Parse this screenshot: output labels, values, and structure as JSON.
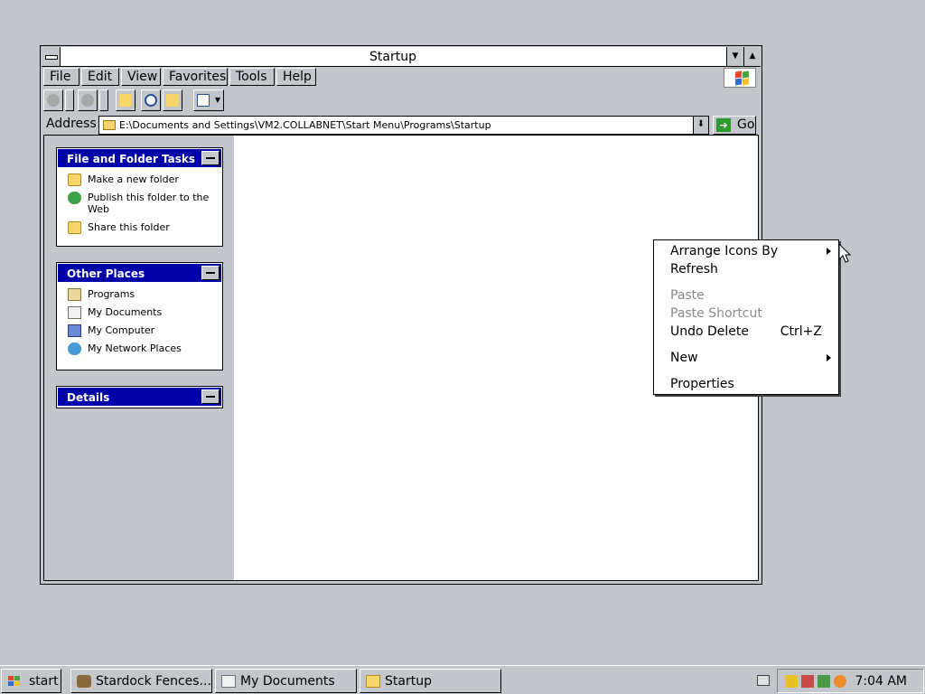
{
  "window": {
    "title": "Startup"
  },
  "menubar": {
    "items": [
      "File",
      "Edit",
      "View",
      "Favorites",
      "Tools",
      "Help"
    ]
  },
  "address": {
    "label": "Address",
    "value": "E:\\Documents and Settings\\VM2.COLLABNET\\Start Menu\\Programs\\Startup",
    "go_label": "Go"
  },
  "tasks": {
    "file_folder": {
      "title": "File and Folder Tasks",
      "items": [
        {
          "label": "Make a new folder",
          "icon": "new-folder-icon"
        },
        {
          "label": "Publish this folder to the Web",
          "icon": "publish-web-icon"
        },
        {
          "label": "Share this folder",
          "icon": "share-folder-icon"
        }
      ]
    },
    "other_places": {
      "title": "Other Places",
      "items": [
        {
          "label": "Programs",
          "icon": "programs-folder-icon"
        },
        {
          "label": "My Documents",
          "icon": "my-documents-icon"
        },
        {
          "label": "My Computer",
          "icon": "my-computer-icon"
        },
        {
          "label": "My Network Places",
          "icon": "network-places-icon"
        }
      ]
    },
    "details": {
      "title": "Details"
    }
  },
  "context_menu": {
    "items": [
      {
        "label": "Arrange Icons By",
        "submenu": true,
        "enabled": true
      },
      {
        "label": "Refresh",
        "enabled": true
      },
      {
        "label": "Paste",
        "enabled": false
      },
      {
        "label": "Paste Shortcut",
        "enabled": false
      },
      {
        "label": "Undo Delete",
        "shortcut": "Ctrl+Z",
        "enabled": true
      },
      {
        "label": "New",
        "submenu": true,
        "enabled": true
      },
      {
        "label": "Properties",
        "enabled": true
      }
    ]
  },
  "taskbar": {
    "start_label": "start",
    "buttons": [
      {
        "label": "Stardock Fences...",
        "icon": "fences-icon"
      },
      {
        "label": "My Documents",
        "icon": "document-icon"
      },
      {
        "label": "Startup",
        "icon": "folder-icon"
      }
    ],
    "clock": "7:04 AM"
  },
  "colors": {
    "panel_header": "#0000a8",
    "desktop": "#c3c7cb",
    "disabled_text": "#8a8a8a"
  }
}
